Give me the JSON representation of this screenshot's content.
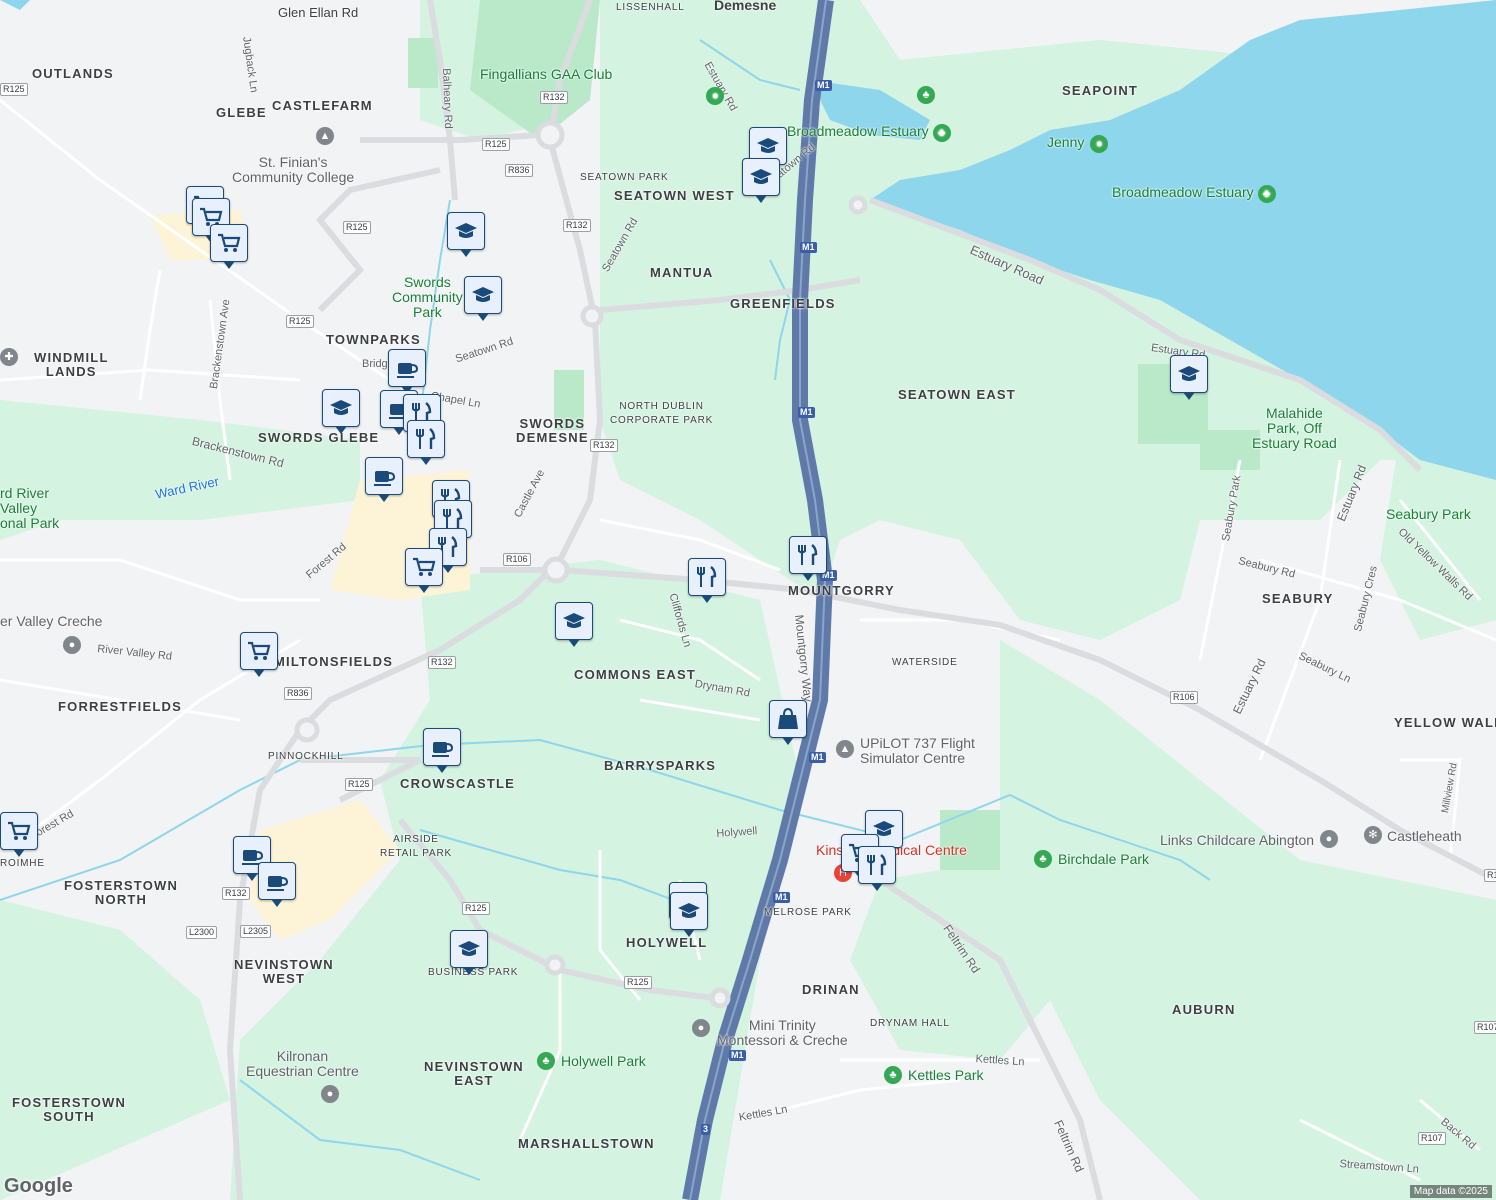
{
  "areas": [
    {
      "key": "glen-ellan-rd",
      "text": "Glen Ellan Rd"
    },
    {
      "key": "lissenhall",
      "text": "LISSENHALL"
    },
    {
      "key": "demesne",
      "text": "Demesne"
    },
    {
      "key": "outlands",
      "text": "OUTLANDS"
    },
    {
      "key": "glebe",
      "text": "GLEBE"
    },
    {
      "key": "castlefarm",
      "text": "CASTLEFARM"
    },
    {
      "key": "seapoint",
      "text": "SEAPOINT"
    },
    {
      "key": "seatown-park",
      "text": "SEATOWN PARK"
    },
    {
      "key": "seatown-west",
      "text": "SEATOWN WEST"
    },
    {
      "key": "mantua",
      "text": "MANTUA"
    },
    {
      "key": "greenfields",
      "text": "GREENFIELDS"
    },
    {
      "key": "townparks",
      "text": "TOWNPARKS"
    },
    {
      "key": "windmill-lands",
      "text": "WINDMILL\nLANDS"
    },
    {
      "key": "swords-glebe",
      "text": "SWORDS GLEBE"
    },
    {
      "key": "swords-demesne",
      "text": "SWORDS\nDEMESNE"
    },
    {
      "key": "north-dublin-corporate-park",
      "text": "NORTH DUBLIN\nCORPORATE PARK"
    },
    {
      "key": "seatown-east",
      "text": "SEATOWN EAST"
    },
    {
      "key": "mountgorry",
      "text": "MOUNTGORRY"
    },
    {
      "key": "seabury",
      "text": "SEABURY"
    },
    {
      "key": "commons-east",
      "text": "COMMONS EAST"
    },
    {
      "key": "waterside",
      "text": "WATERSIDE"
    },
    {
      "key": "miltonsfields",
      "text": "MILTONSFIELDS"
    },
    {
      "key": "forrestfields",
      "text": "FORRESTFIELDS"
    },
    {
      "key": "yellow-walls",
      "text": "YELLOW WALLS"
    },
    {
      "key": "pinnockhill",
      "text": "PINNOCKHILL"
    },
    {
      "key": "crowscastle",
      "text": "CROWSCASTLE"
    },
    {
      "key": "barrysparks",
      "text": "BARRYSPARKS"
    },
    {
      "key": "airside-retail-park",
      "text": "AIRSIDE\nRETAIL PARK"
    },
    {
      "key": "fosterstown-north",
      "text": "FOSTERSTOWN\nNORTH"
    },
    {
      "key": "melrose-park",
      "text": "MELROSE PARK"
    },
    {
      "key": "holywell",
      "text": "HOLYWELL"
    },
    {
      "key": "nevinstown-west",
      "text": "NEVINSTOWN\nWEST"
    },
    {
      "key": "business-park",
      "text": "BUSINESS PARK"
    },
    {
      "key": "drinan",
      "text": "DRINAN"
    },
    {
      "key": "drynam-hall",
      "text": "DRYNAM HALL"
    },
    {
      "key": "auburn",
      "text": "AUBURN"
    },
    {
      "key": "nevinstown-east",
      "text": "NEVINSTOWN\nEAST"
    },
    {
      "key": "fosterstown-south",
      "text": "FOSTERSTOWN\nSOUTH"
    },
    {
      "key": "marshallstown",
      "text": "MARSHALLSTOWN"
    },
    {
      "key": "roimhe",
      "text": "ROIMHE"
    }
  ],
  "roads": [
    {
      "key": "jugback-ln",
      "text": "Jugback Ln"
    },
    {
      "key": "balheary-rd",
      "text": "Balheary Rd"
    },
    {
      "key": "estuary-rd-n",
      "text": "Estuary Rd"
    },
    {
      "key": "seatown-rd-top",
      "text": "Seatown Rd"
    },
    {
      "key": "seatown-rd-diag",
      "text": "Seatown Rd"
    },
    {
      "key": "seatown-rd-low",
      "text": "Seatown Rd"
    },
    {
      "key": "estuary-road",
      "text": "Estuary Road"
    },
    {
      "key": "estuary-rd-e",
      "text": "Estuary Rd"
    },
    {
      "key": "brackenstown-ave",
      "text": "Brackenstown Ave"
    },
    {
      "key": "brackenstown-rd",
      "text": "Brackenstown Rd"
    },
    {
      "key": "chapel-ln",
      "text": "Chapel Ln"
    },
    {
      "key": "bridge",
      "text": "Bridge"
    },
    {
      "key": "castle-ave",
      "text": "Castle Ave"
    },
    {
      "key": "forest-rd",
      "text": "Forest Rd"
    },
    {
      "key": "cliffords-ln",
      "text": "Cliffords Ln"
    },
    {
      "key": "mountgorry-way",
      "text": "Mountgorry Way"
    },
    {
      "key": "drynam-rd",
      "text": "Drynam Rd"
    },
    {
      "key": "river-valley-rd",
      "text": "River Valley Rd"
    },
    {
      "key": "seabury-park",
      "text": "Seabury Park"
    },
    {
      "key": "seabury-rd",
      "text": "Seabury Rd"
    },
    {
      "key": "estuary-rd-se",
      "text": "Estuary Rd"
    },
    {
      "key": "seabury-cres",
      "text": "Seabury Cres"
    },
    {
      "key": "seabury-ln",
      "text": "Seabury Ln"
    },
    {
      "key": "old-yellow-walls-rd",
      "text": "Old Yellow Walls Rd"
    },
    {
      "key": "estuary-rd-e2",
      "text": "Estuary Rd"
    },
    {
      "key": "holywell-rd",
      "text": "Holywell"
    },
    {
      "key": "forest-rd-sw",
      "text": "Forest Rd"
    },
    {
      "key": "feltrim-rd",
      "text": "Feltrim Rd"
    },
    {
      "key": "feltrim-rd-s",
      "text": "Feltrim Rd"
    },
    {
      "key": "millview-rd",
      "text": "Millview Rd"
    },
    {
      "key": "kettles-ln",
      "text": "Kettles Ln"
    },
    {
      "key": "kettles-ln-w",
      "text": "Kettles Ln"
    },
    {
      "key": "back-rd",
      "text": "Back Rd"
    },
    {
      "key": "streamstown-ln",
      "text": "Streamstown Ln"
    }
  ],
  "shields": [
    {
      "key": "r125-a",
      "text": "R125"
    },
    {
      "key": "r132-a",
      "text": "R132"
    },
    {
      "key": "r125-b",
      "text": "R125"
    },
    {
      "key": "r836-a",
      "text": "R836"
    },
    {
      "key": "r132-b",
      "text": "R132"
    },
    {
      "key": "r125-c",
      "text": "R125"
    },
    {
      "key": "r125-d",
      "text": "R125"
    },
    {
      "key": "r132-c",
      "text": "R132"
    },
    {
      "key": "r106-a",
      "text": "R106"
    },
    {
      "key": "r132-d",
      "text": "R132"
    },
    {
      "key": "r836-b",
      "text": "R836"
    },
    {
      "key": "r125-e",
      "text": "R125"
    },
    {
      "key": "r132-e",
      "text": "R132"
    },
    {
      "key": "r125-f",
      "text": "R125"
    },
    {
      "key": "r125-g",
      "text": "R125"
    },
    {
      "key": "r106-b",
      "text": "R106"
    },
    {
      "key": "r107-a",
      "text": "R107"
    },
    {
      "key": "r107-b",
      "text": "R107"
    },
    {
      "key": "r1-a",
      "text": "R1"
    },
    {
      "key": "l2300",
      "text": "L2300"
    },
    {
      "key": "l2305",
      "text": "L2305"
    },
    {
      "key": "m1-a",
      "text": "M1"
    },
    {
      "key": "m1-b",
      "text": "M1"
    },
    {
      "key": "m1-c",
      "text": "M1"
    },
    {
      "key": "m1-d",
      "text": "M1"
    },
    {
      "key": "m1-e",
      "text": "M1"
    },
    {
      "key": "m1-f",
      "text": "M1"
    },
    {
      "key": "m1-g",
      "text": "M1"
    },
    {
      "key": "three",
      "text": "3"
    }
  ],
  "pois": [
    {
      "key": "fingallians",
      "text": "Fingallians GAA Club"
    },
    {
      "key": "broadmeadow-estuary-1",
      "text": "Broadmeadow Estuary"
    },
    {
      "key": "jenny",
      "text": "Jenny"
    },
    {
      "key": "broadmeadow-estuary-2",
      "text": "Broadmeadow Estuary"
    },
    {
      "key": "st-finians",
      "text": "St. Finian's\nCommunity College"
    },
    {
      "key": "swords-community-park",
      "text": "Swords\nCommunity\nPark"
    },
    {
      "key": "malahide-park",
      "text": "Malahide\nPark, Off\nEstuary Road"
    },
    {
      "key": "seabury-park-poi",
      "text": "Seabury Park"
    },
    {
      "key": "ward-river",
      "text": "Ward River"
    },
    {
      "key": "ward-river-valley",
      "text": "rd River\nValley\nonal Park"
    },
    {
      "key": "river-valley-creche",
      "text": "er Valley Creche"
    },
    {
      "key": "upilot",
      "text": "UPiLOT 737 Flight\nSimulator Centre"
    },
    {
      "key": "links-childcare",
      "text": "Links Childcare Abington"
    },
    {
      "key": "castleheath",
      "text": "Castleheath"
    },
    {
      "key": "kinsealy-medical",
      "text": "Kinsealy Medical Centre"
    },
    {
      "key": "birchdale-park",
      "text": "Birchdale Park"
    },
    {
      "key": "mini-trinity",
      "text": "Mini Trinity\nMontessori & Creche"
    },
    {
      "key": "holywell-park",
      "text": "Holywell Park"
    },
    {
      "key": "kettles-park",
      "text": "Kettles Park"
    },
    {
      "key": "kilronan",
      "text": "Kilronan\nEquestrian Centre"
    }
  ],
  "pins": [
    {
      "key": "edu-1",
      "icon": "school"
    },
    {
      "key": "edu-2",
      "icon": "school"
    },
    {
      "key": "cart-1",
      "icon": "cart"
    },
    {
      "key": "cart-2",
      "icon": "cart"
    },
    {
      "key": "cart-3",
      "icon": "cart"
    },
    {
      "key": "edu-3",
      "icon": "school"
    },
    {
      "key": "edu-4",
      "icon": "school"
    },
    {
      "key": "cafe-1",
      "icon": "cafe"
    },
    {
      "key": "edu-5",
      "icon": "school"
    },
    {
      "key": "cafe-2",
      "icon": "cafe"
    },
    {
      "key": "food-1",
      "icon": "food"
    },
    {
      "key": "food-2",
      "icon": "food"
    },
    {
      "key": "edu-6",
      "icon": "school"
    },
    {
      "key": "cafe-3",
      "icon": "cafe"
    },
    {
      "key": "food-3",
      "icon": "food"
    },
    {
      "key": "food-4",
      "icon": "food"
    },
    {
      "key": "food-5",
      "icon": "food"
    },
    {
      "key": "cart-4",
      "icon": "cart"
    },
    {
      "key": "food-6",
      "icon": "food"
    },
    {
      "key": "food-7",
      "icon": "food"
    },
    {
      "key": "edu-7",
      "icon": "school"
    },
    {
      "key": "cart-5",
      "icon": "cart"
    },
    {
      "key": "bag-1",
      "icon": "bag"
    },
    {
      "key": "cafe-4",
      "icon": "cafe"
    },
    {
      "key": "cart-6",
      "icon": "cart"
    },
    {
      "key": "cafe-5",
      "icon": "cafe"
    },
    {
      "key": "cafe-6",
      "icon": "cafe"
    },
    {
      "key": "edu-8",
      "icon": "school"
    },
    {
      "key": "edu-9",
      "icon": "school"
    },
    {
      "key": "edu-10",
      "icon": "school"
    },
    {
      "key": "edu-11",
      "icon": "school"
    },
    {
      "key": "cart-7",
      "icon": "cart"
    },
    {
      "key": "food-8",
      "icon": "food"
    }
  ],
  "attribution": "Map data ©2025",
  "logo": "Google",
  "colors": {
    "water": "#8ed6ec",
    "park": "#cdf2dc",
    "urban": "#f1f3f4",
    "motorway": "#5f7aa8",
    "pin_border": "#1a4a7a",
    "retail": "#fdf3d6"
  }
}
